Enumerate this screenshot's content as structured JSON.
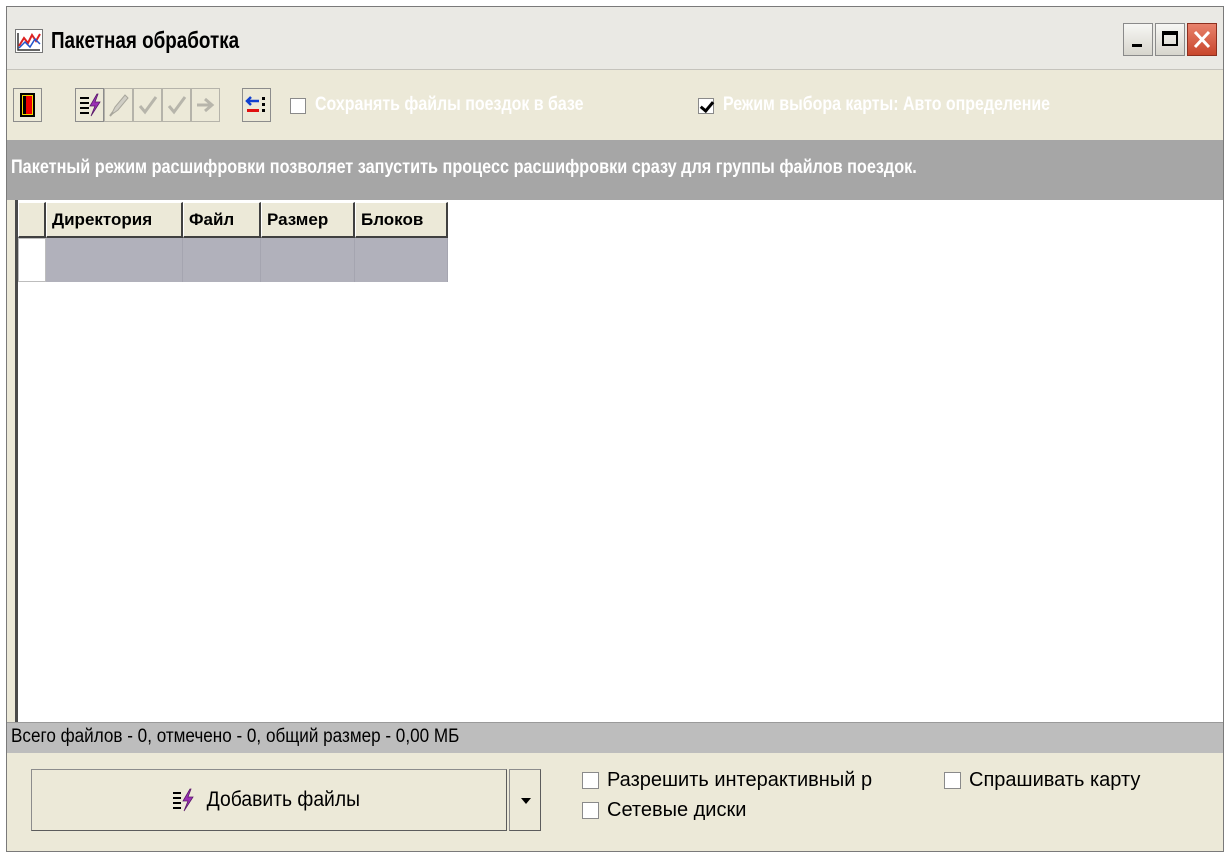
{
  "window": {
    "title": "Пакетная обработка"
  },
  "toolbar": {
    "save_trips_label": "Сохранять файлы поездок в базе",
    "save_trips_checked": false,
    "map_mode_label": "Режим выбора карты: Авто определение",
    "map_mode_checked": true
  },
  "info": {
    "text": "Пакетный режим расшифровки позволяет запустить процесс расшифровки сразу для группы файлов поездок."
  },
  "grid": {
    "columns": [
      "Директория",
      "Файл",
      "Размер",
      "Блоков"
    ],
    "rows": [
      [
        "",
        "",
        "",
        ""
      ]
    ]
  },
  "status": {
    "text": "Всего файлов - 0, отмечено - 0, общий размер - 0,00 МБ"
  },
  "bottom": {
    "add_files_label": "Добавить файлы",
    "interactive_label": "Разрешить интерактивный р",
    "interactive_checked": false,
    "ask_map_label": "Спрашивать карту",
    "ask_map_checked": false,
    "network_drives_label": "Сетевые диски",
    "network_drives_checked": false
  },
  "colors": {
    "window_bg": "#ece9d8",
    "info_bar_bg": "#a6a6a6",
    "grid_row_bg": "#b1b1bb",
    "status_bar_bg": "#bdbdbd",
    "close_button": "#c8462c"
  }
}
